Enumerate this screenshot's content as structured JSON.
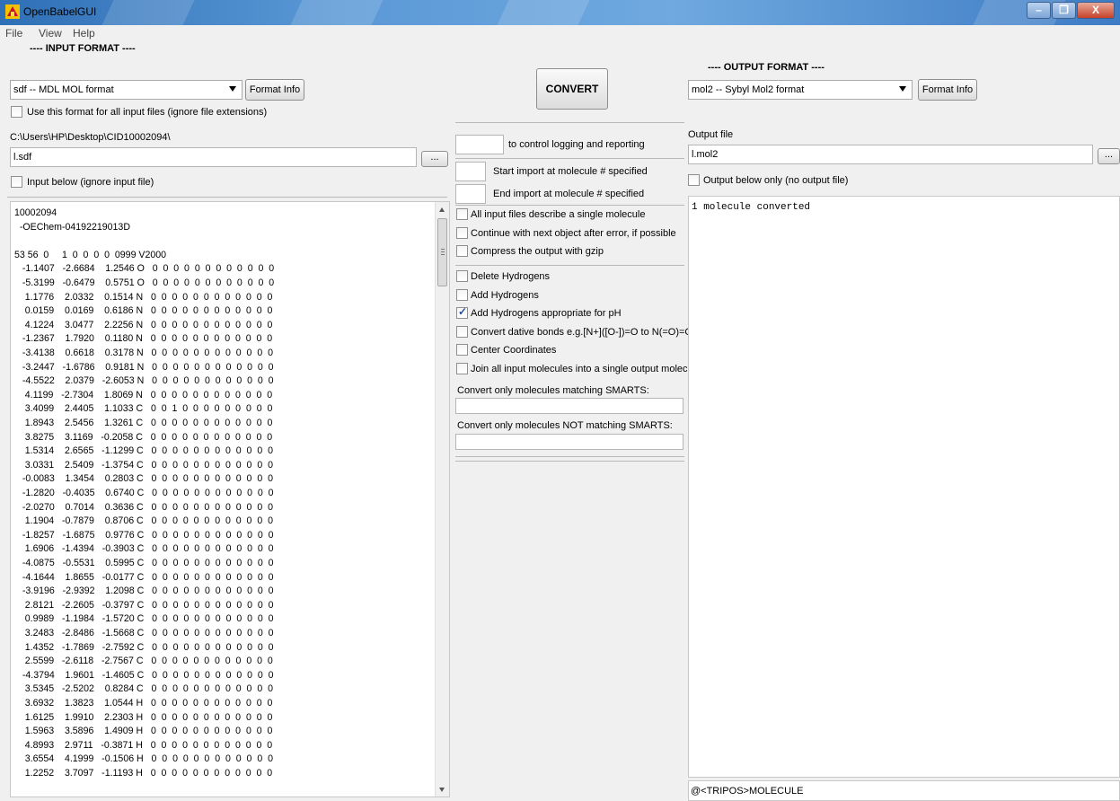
{
  "window": {
    "title": "OpenBabelGUI"
  },
  "menu": [
    "File",
    "View",
    "Help"
  ],
  "input": {
    "header": "---- INPUT FORMAT ----",
    "format": "sdf -- MDL MOL format",
    "format_info_label": "Format Info",
    "use_for_all_label": "Use this format for all input files (ignore file extensions)",
    "directory": "C:\\Users\\HP\\Desktop\\CID10002094\\",
    "file": "l.sdf",
    "browse_label": "...",
    "input_below_label": "Input below (ignore input file)",
    "lines": [
      "10002094",
      "  -OEChem-04192219013D",
      "",
      "53 56  0     1  0  0  0  0  0999 V2000",
      "   -1.1407   -2.6684    1.2546 O   0  0  0  0  0  0  0  0  0  0  0  0",
      "   -5.3199   -0.6479    0.5751 O   0  0  0  0  0  0  0  0  0  0  0  0",
      "    1.1776    2.0332    0.1514 N   0  0  0  0  0  0  0  0  0  0  0  0",
      "    0.0159    0.0169    0.6186 N   0  0  0  0  0  0  0  0  0  0  0  0",
      "    4.1224    3.0477    2.2256 N   0  0  0  0  0  0  0  0  0  0  0  0",
      "   -1.2367    1.7920    0.1180 N   0  0  0  0  0  0  0  0  0  0  0  0",
      "   -3.4138    0.6618    0.3178 N   0  0  0  0  0  0  0  0  0  0  0  0",
      "   -3.2447   -1.6786    0.9181 N   0  0  0  0  0  0  0  0  0  0  0  0",
      "   -4.5522    2.0379   -2.6053 N   0  0  0  0  0  0  0  0  0  0  0  0",
      "    4.1199   -2.7304    1.8069 N   0  0  0  0  0  0  0  0  0  0  0  0",
      "    3.4099    2.4405    1.1033 C   0  0  1  0  0  0  0  0  0  0  0  0",
      "    1.8943    2.5456    1.3261 C   0  0  0  0  0  0  0  0  0  0  0  0",
      "    3.8275    3.1169   -0.2058 C   0  0  0  0  0  0  0  0  0  0  0  0",
      "    1.5314    2.6565   -1.1299 C   0  0  0  0  0  0  0  0  0  0  0  0",
      "    3.0331    2.5409   -1.3754 C   0  0  0  0  0  0  0  0  0  0  0  0",
      "   -0.0083    1.3454    0.2803 C   0  0  0  0  0  0  0  0  0  0  0  0",
      "   -1.2820   -0.4035    0.6740 C   0  0  0  0  0  0  0  0  0  0  0  0",
      "   -2.0270    0.7014    0.3636 C   0  0  0  0  0  0  0  0  0  0  0  0",
      "    1.1904   -0.7879    0.8706 C   0  0  0  0  0  0  0  0  0  0  0  0",
      "   -1.8257   -1.6875    0.9776 C   0  0  0  0  0  0  0  0  0  0  0  0",
      "    1.6906   -1.4394   -0.3903 C   0  0  0  0  0  0  0  0  0  0  0  0",
      "   -4.0875   -0.5531    0.5995 C   0  0  0  0  0  0  0  0  0  0  0  0",
      "   -4.1644    1.8655   -0.0177 C   0  0  0  0  0  0  0  0  0  0  0  0",
      "   -3.9196   -2.9392    1.2098 C   0  0  0  0  0  0  0  0  0  0  0  0",
      "    2.8121   -2.2605   -0.3797 C   0  0  0  0  0  0  0  0  0  0  0  0",
      "    0.9989   -1.1984   -1.5720 C   0  0  0  0  0  0  0  0  0  0  0  0",
      "    3.2483   -2.8486   -1.5668 C   0  0  0  0  0  0  0  0  0  0  0  0",
      "    1.4352   -1.7869   -2.7592 C   0  0  0  0  0  0  0  0  0  0  0  0",
      "    2.5599   -2.6118   -2.7567 C   0  0  0  0  0  0  0  0  0  0  0  0",
      "   -4.3794    1.9601   -1.4605 C   0  0  0  0  0  0  0  0  0  0  0  0",
      "    3.5345   -2.5202    0.8284 C   0  0  0  0  0  0  0  0  0  0  0  0",
      "    3.6932    1.3823    1.0544 H   0  0  0  0  0  0  0  0  0  0  0  0",
      "    1.6125    1.9910    2.2303 H   0  0  0  0  0  0  0  0  0  0  0  0",
      "    1.5963    3.5896    1.4909 H   0  0  0  0  0  0  0  0  0  0  0  0",
      "    4.8993    2.9711   -0.3871 H   0  0  0  0  0  0  0  0  0  0  0  0",
      "    3.6554    4.1999   -0.1506 H   0  0  0  0  0  0  0  0  0  0  0  0",
      "    1.2252    3.7097   -1.1193 H   0  0  0  0  0  0  0  0  0  0  0  0"
    ]
  },
  "middle": {
    "convert_label": "CONVERT",
    "logging_label": "to control logging and reporting",
    "start_label": "Start import at molecule # specified",
    "end_label": "End import at molecule # specified",
    "options": [
      {
        "label": "All input files describe a single molecule",
        "checked": false
      },
      {
        "label": "Continue with next object after error, if possible",
        "checked": false
      },
      {
        "label": "Compress the output with gzip",
        "checked": false
      }
    ],
    "options2": [
      {
        "label": "Delete Hydrogens",
        "checked": false
      },
      {
        "label": "Add Hydrogens",
        "checked": false
      },
      {
        "label": "Add Hydrogens appropriate for pH",
        "checked": true
      },
      {
        "label": "Convert dative bonds e.g.[N+]([O-])=O to N(=O)=O",
        "checked": false
      },
      {
        "label": "Center Coordinates",
        "checked": false
      },
      {
        "label": "Join all input molecules into a single output molecule",
        "checked": false
      }
    ],
    "smarts_label": "Convert only molecules matching SMARTS:",
    "not_smarts_label": "Convert only molecules NOT matching SMARTS:"
  },
  "output": {
    "header": "---- OUTPUT FORMAT ----",
    "format": "mol2 -- Sybyl Mol2 format",
    "format_info_label": "Format Info",
    "file_label": "Output file",
    "file": "l.mol2",
    "browse_label": "...",
    "below_only_label": "Output below only (no output file)",
    "message": "1 molecule converted",
    "output_text": "@<TRIPOS>MOLECULE"
  }
}
